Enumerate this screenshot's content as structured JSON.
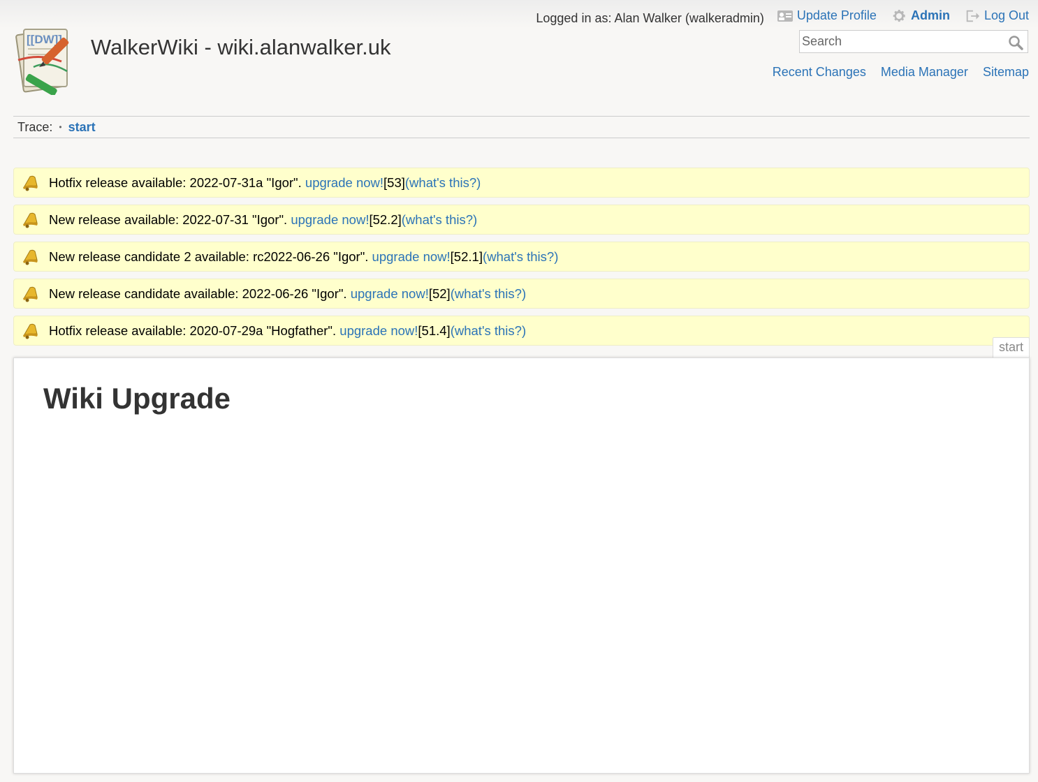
{
  "site": {
    "title": "WalkerWiki - wiki.alanwalker.uk"
  },
  "user_tools": {
    "logged_in": "Logged in as: Alan Walker (walkeradmin)",
    "update_profile": "Update Profile",
    "admin": "Admin",
    "logout": "Log Out"
  },
  "search": {
    "placeholder": "Search",
    "icon": "magnifier-icon"
  },
  "site_tools": {
    "recent_changes": "Recent Changes",
    "media_manager": "Media Manager",
    "sitemap": "Sitemap"
  },
  "breadcrumb": {
    "label": "Trace:",
    "separator": "•",
    "page": "start"
  },
  "notices": [
    {
      "text": "Hotfix release available: 2022-07-31a \"Igor\". ",
      "upgrade": "upgrade now!",
      "id": " [53] ",
      "help": "(what's this?)"
    },
    {
      "text": "New release available: 2022-07-31 \"Igor\". ",
      "upgrade": "upgrade now!",
      "id": " [52.2] ",
      "help": "(what's this?)"
    },
    {
      "text": "New release candidate 2 available: rc2022-06-26 \"Igor\". ",
      "upgrade": "upgrade now!",
      "id": " [52.1] ",
      "help": "(what's this?)"
    },
    {
      "text": "New release candidate available: 2022-06-26 \"Igor\". ",
      "upgrade": "upgrade now!",
      "id": " [52] ",
      "help": "(what's this?)"
    },
    {
      "text": "Hotfix release available: 2020-07-29a \"Hogfather\". ",
      "upgrade": "upgrade now!",
      "id": " [51.4] ",
      "help": "(what's this?)"
    }
  ],
  "page": {
    "id": "start",
    "heading": "Wiki Upgrade"
  },
  "colors": {
    "link": "#2b73b7",
    "notice_bg": "#ffffcc",
    "background": "#f8f7f5"
  }
}
